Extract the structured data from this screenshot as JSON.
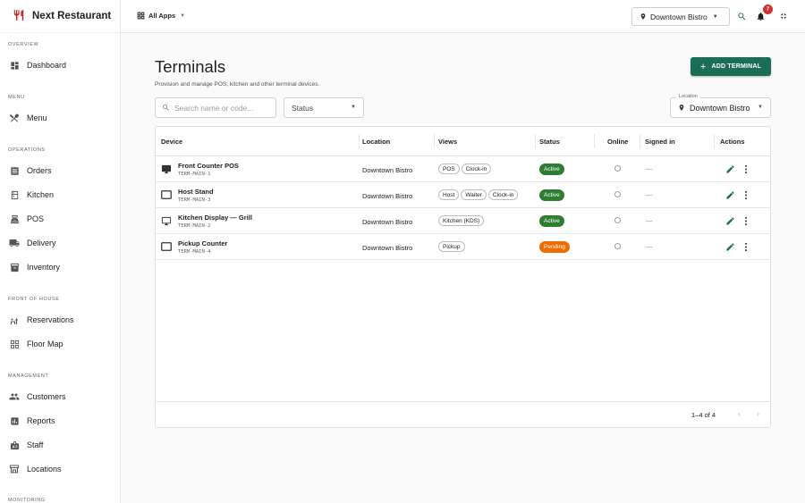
{
  "app": {
    "name": "Next Restaurant"
  },
  "sidebar": {
    "sections": {
      "overview": "OVERVIEW",
      "menu": "MENU",
      "operations": "OPERATIONS",
      "front_of_house": "FRONT OF HOUSE",
      "management": "MANAGEMENT",
      "monitoring": "MONITORING"
    },
    "items": {
      "dashboard": "Dashboard",
      "menu": "Menu",
      "orders": "Orders",
      "kitchen": "Kitchen",
      "pos": "POS",
      "delivery": "Delivery",
      "inventory": "Inventory",
      "reservations": "Reservations",
      "floor_map": "Floor Map",
      "customers": "Customers",
      "reports": "Reports",
      "staff": "Staff",
      "locations": "Locations"
    }
  },
  "topbar": {
    "all_apps": "All Apps",
    "location": "Downtown Bistro",
    "notification_count": "7"
  },
  "page": {
    "title": "Terminals",
    "subtitle": "Provision and manage POS, kitchen and other terminal devices.",
    "add_button": "ADD TERMINAL"
  },
  "filters": {
    "search_placeholder": "Search name or code...",
    "status_label": "Status",
    "location_legend": "Location",
    "location_value": "Downtown Bistro"
  },
  "table": {
    "headers": {
      "device": "Device",
      "location": "Location",
      "views": "Views",
      "status": "Status",
      "online": "Online",
      "signed_in": "Signed in",
      "actions": "Actions"
    },
    "rows": [
      {
        "name": "Front Counter POS",
        "code": "TERM-MAIN-1",
        "location": "Downtown Bistro",
        "views": [
          "POS",
          "Clock-in"
        ],
        "status": "Active",
        "signed_in": "—",
        "icon": "desktop-icon"
      },
      {
        "name": "Host Stand",
        "code": "TERM-MAIN-3",
        "location": "Downtown Bistro",
        "views": [
          "Host",
          "Waiter",
          "Clock-in"
        ],
        "status": "Active",
        "signed_in": "—",
        "icon": "tablet-icon"
      },
      {
        "name": "Kitchen Display — Grill",
        "code": "TERM-MAIN-2",
        "location": "Downtown Bistro",
        "views": [
          "Kitchen (KDS)"
        ],
        "status": "Active",
        "signed_in": "—",
        "icon": "monitor-icon"
      },
      {
        "name": "Pickup Counter",
        "code": "TERM-MAIN-4",
        "location": "Downtown Bistro",
        "views": [
          "Pickup"
        ],
        "status": "Pending",
        "signed_in": "—",
        "icon": "tablet-icon"
      }
    ],
    "pagination": "1–4 of 4"
  },
  "colors": {
    "primary": "#1b6e55",
    "active": "#2e7d32",
    "pending": "#ef6c00",
    "brand_icon": "#c62828",
    "badge": "#d32f2f"
  }
}
